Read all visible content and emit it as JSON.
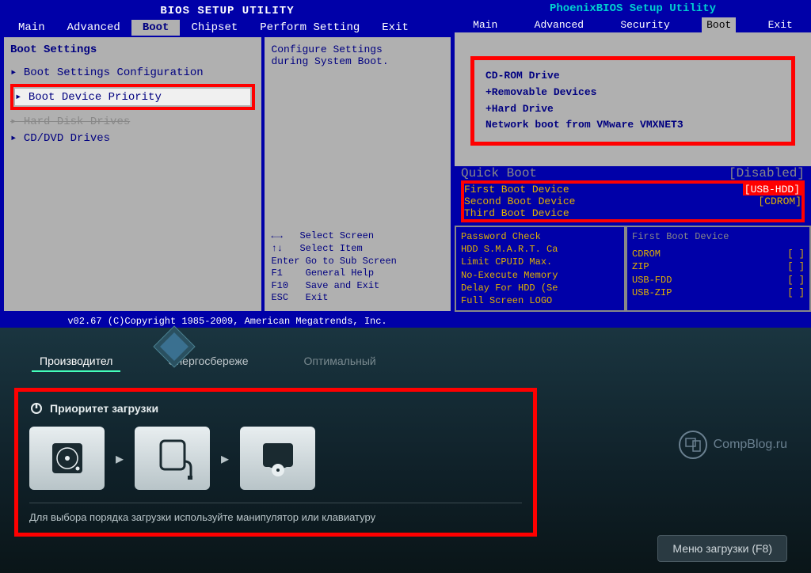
{
  "ami": {
    "title": "BIOS SETUP UTILITY",
    "menu": [
      "Main",
      "Advanced",
      "Boot",
      "Chipset",
      "Perform Setting",
      "Exit"
    ],
    "active_menu": "Boot",
    "section": "Boot Settings",
    "items": [
      "▸ Boot Settings Configuration",
      "▸ Boot Device Priority",
      "▸ Hard Disk Drives",
      "▸ CD/DVD Drives"
    ],
    "highlighted_item_index": 1,
    "desc1": "Configure Settings",
    "desc2": "during System Boot.",
    "help": [
      "←→   Select Screen",
      "↑↓   Select Item",
      "Enter Go to Sub Screen",
      "F1    General Help",
      "F10   Save and Exit",
      "ESC   Exit"
    ],
    "footer": "v02.67 (C)Copyright 1985-2009, American Megatrends, Inc."
  },
  "phoenix": {
    "title": "PhoenixBIOS Setup Utility",
    "menu": [
      "Main",
      "Advanced",
      "Security",
      "Boot",
      "Exit"
    ],
    "active_menu": "Boot",
    "boot_order": [
      "CD-ROM Drive",
      "+Removable Devices",
      "+Hard Drive",
      "Network boot from VMware VMXNET3"
    ]
  },
  "award": {
    "quick_boot_label": "Quick Boot",
    "quick_boot_value": "[Disabled]",
    "rows": [
      {
        "label": "First Boot Device",
        "value": "[USB-HDD]",
        "red": true
      },
      {
        "label": "Second Boot Device",
        "value": "[CDROM]",
        "red": false
      },
      {
        "label": "Third Boot Device",
        "value": "",
        "red": false
      }
    ],
    "left_items": [
      "Password Check",
      "HDD S.M.A.R.T. Ca",
      "Limit CPUID Max.",
      "No-Execute Memory",
      "Delay For HDD (Se",
      "Full Screen LOGO"
    ],
    "right_header": "First Boot Device",
    "right_items": [
      {
        "name": "CDROM",
        "mark": "[ ]"
      },
      {
        "name": "ZIP",
        "mark": "[ ]"
      },
      {
        "name": "USB-FDD",
        "mark": "[ ]"
      },
      {
        "name": "USB-ZIP",
        "mark": "[ ]"
      }
    ]
  },
  "efi": {
    "tabs": [
      "Производител",
      "Энергосбереже",
      "Оптимальный"
    ],
    "active_tab_index": 0,
    "heading": "Приоритет загрузки",
    "hint": "Для выбора порядка загрузки используйте манипулятор или клавиатуру",
    "logo_text": "CompBlog.ru",
    "button": "Меню загрузки (F8)",
    "boot_devices": [
      "hard-drive",
      "external-drive",
      "optical-drive"
    ]
  }
}
